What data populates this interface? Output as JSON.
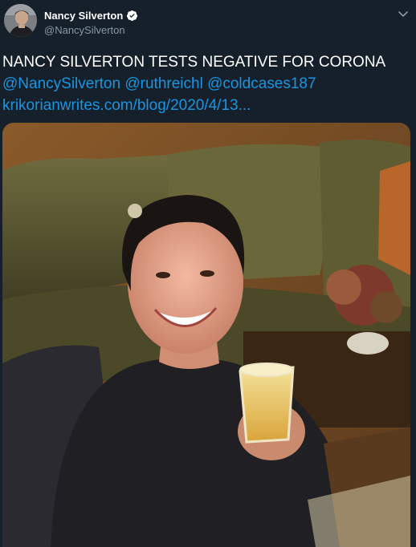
{
  "author": {
    "display_name": "Nancy Silverton",
    "handle": "@NancySilverton",
    "verified": true
  },
  "tweet": {
    "text": "NANCY SILVERTON TESTS NEGATIVE FOR CORONA",
    "mentions": [
      "@NancySilverton",
      "@ruthreichl",
      "@coldcases187"
    ],
    "link": "krikorianwrites.com/blog/2020/4/13..."
  },
  "icons": {
    "verified": "verified-badge-icon",
    "menu": "chevron-down-icon"
  },
  "colors": {
    "background": "#15202b",
    "link": "#1b95e0",
    "secondary_text": "#8899a6",
    "verified_badge": "#ffffff"
  }
}
